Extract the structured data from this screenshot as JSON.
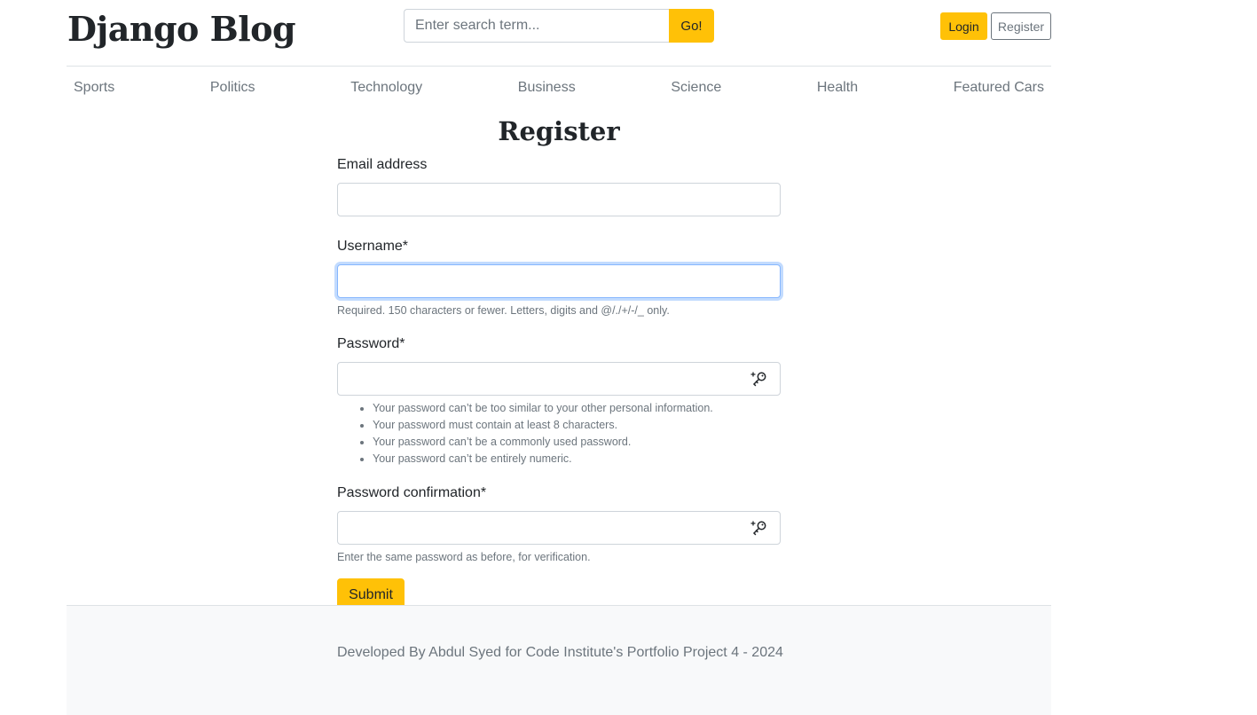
{
  "header": {
    "brand": "Django Blog",
    "search": {
      "placeholder": "Enter search term...",
      "value": "",
      "button_label": "Go!"
    },
    "auth": {
      "login_label": "Login",
      "register_label": "Register"
    }
  },
  "nav": {
    "categories": [
      "Sports",
      "Politics",
      "Technology",
      "Business",
      "Science",
      "Health",
      "Featured Cars"
    ]
  },
  "form": {
    "title": "Register",
    "email": {
      "label": "Email address",
      "value": ""
    },
    "username": {
      "label": "Username*",
      "value": "",
      "help": "Required. 150 characters or fewer. Letters, digits and @/./+/-/_ only."
    },
    "password": {
      "label": "Password*",
      "value": "",
      "icon": "key-suggest-icon",
      "rules": [
        "Your password can’t be too similar to your other personal information.",
        "Your password must contain at least 8 characters.",
        "Your password can’t be a commonly used password.",
        "Your password can’t be entirely numeric."
      ]
    },
    "password_confirmation": {
      "label": "Password confirmation*",
      "value": "",
      "icon": "key-suggest-icon",
      "help": "Enter the same password as before, for verification."
    },
    "submit_label": "Submit"
  },
  "footer": {
    "text": "Developed By Abdul Syed for Code Institute's Portfolio Project 4 - 2024"
  },
  "colors": {
    "accent": "#ffc107",
    "muted_text": "#6c757d",
    "focus_border": "#86b7fe",
    "footer_bg": "#f8f9fa"
  }
}
